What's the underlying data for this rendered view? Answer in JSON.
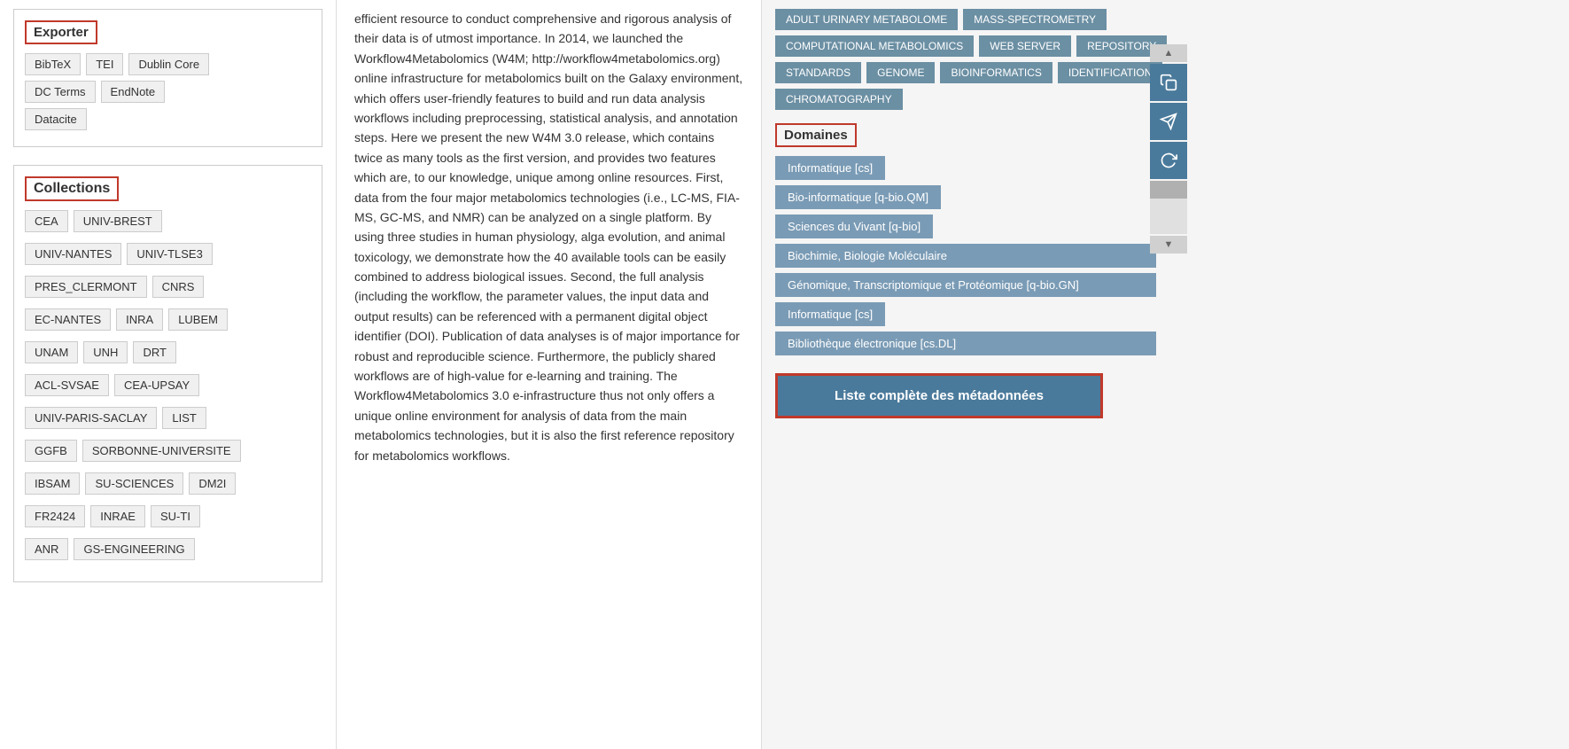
{
  "exporter": {
    "title": "Exporter",
    "buttons": [
      "BibTeX",
      "TEI",
      "Dublin Core",
      "DC Terms",
      "EndNote",
      "Datacite"
    ]
  },
  "collections": {
    "title": "Collections",
    "tags": [
      "CEA",
      "UNIV-BREST",
      "UNIV-NANTES",
      "UNIV-TLSE3",
      "PRES_CLERMONT",
      "CNRS",
      "EC-NANTES",
      "INRA",
      "LUBEM",
      "UNAM",
      "UNH",
      "DRT",
      "ACL-SVSAE",
      "CEA-UPSAY",
      "UNIV-PARIS-SACLAY",
      "LIST",
      "GGFB",
      "SORBONNE-UNIVERSITE",
      "IBSAM",
      "SU-SCIENCES",
      "DM2I",
      "FR2424",
      "INRAE",
      "SU-TI",
      "ANR",
      "GS-ENGINEERING"
    ]
  },
  "main": {
    "description": "efficient resource to conduct comprehensive and rigorous analysis of their data is of utmost importance. In 2014, we launched the Workflow4Metabolomics (W4M; http://workflow4metabolomics.org) online infrastructure for metabolomics built on the Galaxy environment, which offers user-friendly features to build and run data analysis workflows including preprocessing, statistical analysis, and annotation steps. Here we present the new W4M 3.0 release, which contains twice as many tools as the first version, and provides two features which are, to our knowledge, unique among online resources. First, data from the four major metabolomics technologies (i.e., LC-MS, FIA-MS, GC-MS, and NMR) can be analyzed on a single platform. By using three studies in human physiology, alga evolution, and animal toxicology, we demonstrate how the 40 available tools can be easily combined to address biological issues. Second, the full analysis (including the workflow, the parameter values, the input data and output results) can be referenced with a permanent digital object identifier (DOI). Publication of data analyses is of major importance for robust and reproducible science. Furthermore, the publicly shared workflows are of high-value for e-learning and training. The Workflow4Metabolomics 3.0 e-infrastructure thus not only offers a unique online environment for analysis of data from the main metabolomics technologies, but it is also the first reference repository for metabolomics workflows."
  },
  "keywords": {
    "tags": [
      "ADULT URINARY METABOLOME",
      "MASS-SPECTROMETRY",
      "COMPUTATIONAL METABOLOMICS",
      "WEB SERVER",
      "REPOSITORY",
      "STANDARDS",
      "GENOME",
      "BIOINFORMATICS",
      "IDENTIFICATION",
      "CHROMATOGRAPHY"
    ]
  },
  "domaines": {
    "title": "Domaines",
    "tags": [
      "Informatique [cs]",
      "Bio-informatique [q-bio.QM]",
      "Sciences du Vivant [q-bio]",
      "Biochimie, Biologie Moléculaire",
      "Génomique, Transcriptomique et Protéomique [q-bio.GN]",
      "Informatique [cs]",
      "Bibliothèque électronique [cs.DL]"
    ]
  },
  "actions": {
    "liste_button": "Liste complète des métadonnées"
  },
  "sidebar": {
    "icons": [
      "📋",
      "✉",
      "↻"
    ]
  }
}
